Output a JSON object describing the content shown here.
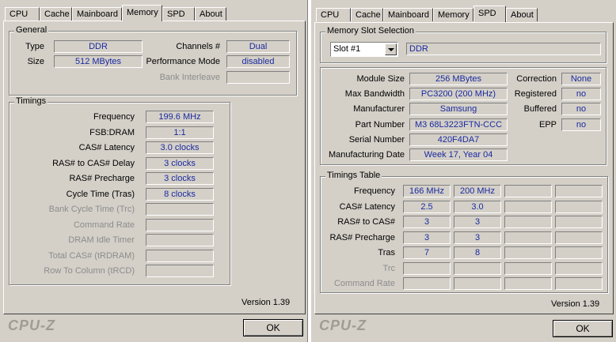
{
  "left": {
    "tabs": [
      "CPU",
      "Cache",
      "Mainboard",
      "Memory",
      "SPD",
      "About"
    ],
    "active_tab": "Memory",
    "general": {
      "title": "General",
      "type_label": "Type",
      "type_value": "DDR",
      "size_label": "Size",
      "size_value": "512 MBytes",
      "channels_label": "Channels #",
      "channels_value": "Dual",
      "perf_label": "Performance Mode",
      "perf_value": "disabled",
      "bank_label": "Bank Interleave",
      "bank_value": ""
    },
    "timings": {
      "title": "Timings",
      "rows": [
        {
          "label": "Frequency",
          "value": "199.6 MHz",
          "enabled": true
        },
        {
          "label": "FSB:DRAM",
          "value": "1:1",
          "enabled": true
        },
        {
          "label": "CAS# Latency",
          "value": "3.0 clocks",
          "enabled": true
        },
        {
          "label": "RAS# to CAS# Delay",
          "value": "3 clocks",
          "enabled": true
        },
        {
          "label": "RAS# Precharge",
          "value": "3 clocks",
          "enabled": true
        },
        {
          "label": "Cycle Time (Tras)",
          "value": "8 clocks",
          "enabled": true
        },
        {
          "label": "Bank Cycle Time (Trc)",
          "value": "",
          "enabled": false
        },
        {
          "label": "Command Rate",
          "value": "",
          "enabled": false
        },
        {
          "label": "DRAM Idle Timer",
          "value": "",
          "enabled": false
        },
        {
          "label": "Total CAS# (tRDRAM)",
          "value": "",
          "enabled": false
        },
        {
          "label": "Row To Column (tRCD)",
          "value": "",
          "enabled": false
        }
      ]
    },
    "version": "Version 1.39",
    "logo": "CPU-Z",
    "ok": "OK"
  },
  "right": {
    "tabs": [
      "CPU",
      "Cache",
      "Mainboard",
      "Memory",
      "SPD",
      "About"
    ],
    "active_tab": "SPD",
    "slot_selection": {
      "title": "Memory Slot Selection",
      "slot_value": "Slot #1",
      "slot_type": "DDR"
    },
    "module": {
      "size_label": "Module Size",
      "size_value": "256 MBytes",
      "bw_label": "Max Bandwidth",
      "bw_value": "PC3200 (200 MHz)",
      "mfr_label": "Manufacturer",
      "mfr_value": "Samsung",
      "part_label": "Part Number",
      "part_value": "M3 68L3223FTN-CCC",
      "serial_label": "Serial Number",
      "serial_value": "420F4DA7",
      "date_label": "Manufacturing Date",
      "date_value": "Week 17, Year 04",
      "correction_label": "Correction",
      "correction_value": "None",
      "registered_label": "Registered",
      "registered_value": "no",
      "buffered_label": "Buffered",
      "buffered_value": "no",
      "epp_label": "EPP",
      "epp_value": "no"
    },
    "timings_table": {
      "title": "Timings Table",
      "rows": [
        {
          "label": "Frequency",
          "values": [
            "166 MHz",
            "200 MHz",
            "",
            ""
          ],
          "enabled": true
        },
        {
          "label": "CAS# Latency",
          "values": [
            "2.5",
            "3.0",
            "",
            ""
          ],
          "enabled": true
        },
        {
          "label": "RAS# to CAS#",
          "values": [
            "3",
            "3",
            "",
            ""
          ],
          "enabled": true
        },
        {
          "label": "RAS# Precharge",
          "values": [
            "3",
            "3",
            "",
            ""
          ],
          "enabled": true
        },
        {
          "label": "Tras",
          "values": [
            "7",
            "8",
            "",
            ""
          ],
          "enabled": true
        },
        {
          "label": "Trc",
          "values": [
            "",
            "",
            "",
            ""
          ],
          "enabled": false
        },
        {
          "label": "Command Rate",
          "values": [
            "",
            "",
            "",
            ""
          ],
          "enabled": false
        }
      ]
    },
    "version": "Version 1.39",
    "logo": "CPU-Z",
    "ok": "OK"
  }
}
